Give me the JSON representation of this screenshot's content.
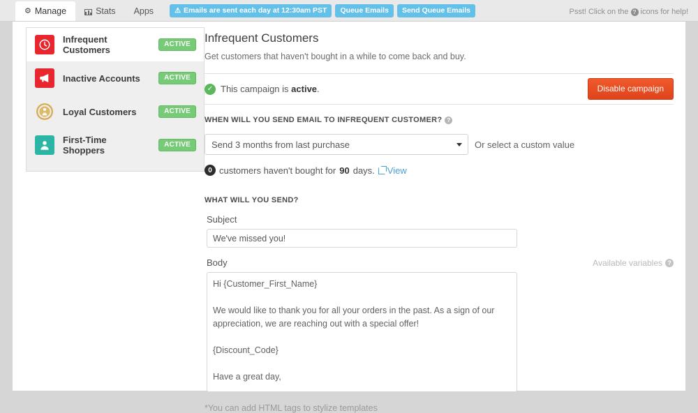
{
  "topbar": {
    "tabs": [
      {
        "label": "Manage",
        "icon": "gear-icon",
        "active": true
      },
      {
        "label": "Stats",
        "icon": "bar-chart-icon",
        "active": false
      },
      {
        "label": "Apps",
        "icon": "",
        "active": false
      }
    ],
    "pills": [
      {
        "label": "Emails are sent each day at 12:30am PST",
        "icon": "warning-triangle-icon"
      },
      {
        "label": "Queue Emails",
        "icon": ""
      },
      {
        "label": "Send Queue Emails",
        "icon": ""
      }
    ],
    "help_prefix": "Psst! Click on the",
    "help_suffix": "icons for help!",
    "pill_color": "#63c0e8"
  },
  "sidebar": {
    "items": [
      {
        "label": "Infrequent Customers",
        "badge": "ACTIVE",
        "icon": "clock-icon",
        "color": "#e8262d",
        "selected": true
      },
      {
        "label": "Inactive Accounts",
        "badge": "ACTIVE",
        "icon": "megaphone-icon",
        "color": "#e8262d",
        "selected": false
      },
      {
        "label": "Loyal Customers",
        "badge": "ACTIVE",
        "icon": "medal-icon",
        "color": "#d4a847",
        "selected": false
      },
      {
        "label": "First-Time Shoppers",
        "badge": "ACTIVE",
        "icon": "person-icon",
        "color": "#2ab5a5",
        "selected": false
      }
    ],
    "badge_color": "#76cb76"
  },
  "main": {
    "title": "Infrequent Customers",
    "subtitle": "Get customers that haven't bought in a while to come back and buy.",
    "status_prefix": "This campaign is",
    "status_state": "active",
    "status_suffix": ".",
    "disable_button": "Disable campaign",
    "disable_color": "#e8502a",
    "when_section_label": "WHEN WILL YOU SEND EMAIL TO INFREQUENT CUSTOMER?",
    "select_value": "Send 3 months from last purchase",
    "select_hint": "Or select a custom value",
    "count_value": "0",
    "count_text_before": "customers haven't bought for",
    "count_days": "90",
    "count_text_after": "days.",
    "view_link": "View",
    "what_section_label": "WHAT WILL YOU SEND?",
    "subject_label": "Subject",
    "subject_value": "We've missed you!",
    "body_label": "Body",
    "available_variables": "Available variables",
    "body_value": "Hi {Customer_First_Name}\n\nWe would like to thank you for all your orders in the past. As a sign of our appreciation, we are reaching out with a special offer!\n\n{Discount_Code}\n\nHave a great day,\n\n{Store_Name}",
    "foot_note": "*You can add HTML tags to stylize templates"
  }
}
